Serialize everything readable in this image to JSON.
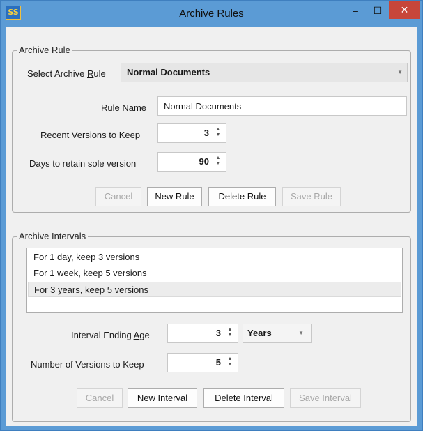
{
  "window": {
    "title": "Archive Rules",
    "app_icon_text": "SS",
    "minimize_glyph": "–",
    "maximize_glyph": "☐",
    "close_glyph": "✕"
  },
  "archive_rule": {
    "group_label": "Archive Rule",
    "select_label_pre": "Select Archive ",
    "select_label_u": "R",
    "select_label_post": "ule",
    "selected_rule": "Normal Documents",
    "rule_name_label_pre": "Rule ",
    "rule_name_label_u": "N",
    "rule_name_label_post": "ame",
    "rule_name_value": "Normal Documents",
    "recent_versions_label": "Recent Versions to Keep",
    "recent_versions_value": "3",
    "days_retain_label": "Days to retain sole version",
    "days_retain_value": "90",
    "buttons": {
      "cancel": "Cancel",
      "new_rule": "New Rule",
      "delete_rule": "Delete Rule",
      "save_rule": "Save Rule"
    }
  },
  "archive_intervals": {
    "group_label": "Archive Intervals",
    "items": [
      "For 1 day, keep 3 versions",
      "For 1 week, keep 5 versions",
      "For 3 years, keep 5 versions"
    ],
    "selected_index": 2,
    "interval_age_label_pre": "Interval Ending ",
    "interval_age_label_u": "A",
    "interval_age_label_post": "ge",
    "interval_age_value": "3",
    "interval_unit": "Years",
    "num_versions_label": "Number of Versions to Keep",
    "num_versions_value": "5",
    "buttons": {
      "cancel": "Cancel",
      "new_interval": "New Interval",
      "delete_interval": "Delete Interval",
      "save_interval": "Save Interval"
    }
  },
  "colors": {
    "titlebar": "#5b9bd5",
    "close_button": "#c7463a",
    "client_bg": "#f0f0f0"
  }
}
